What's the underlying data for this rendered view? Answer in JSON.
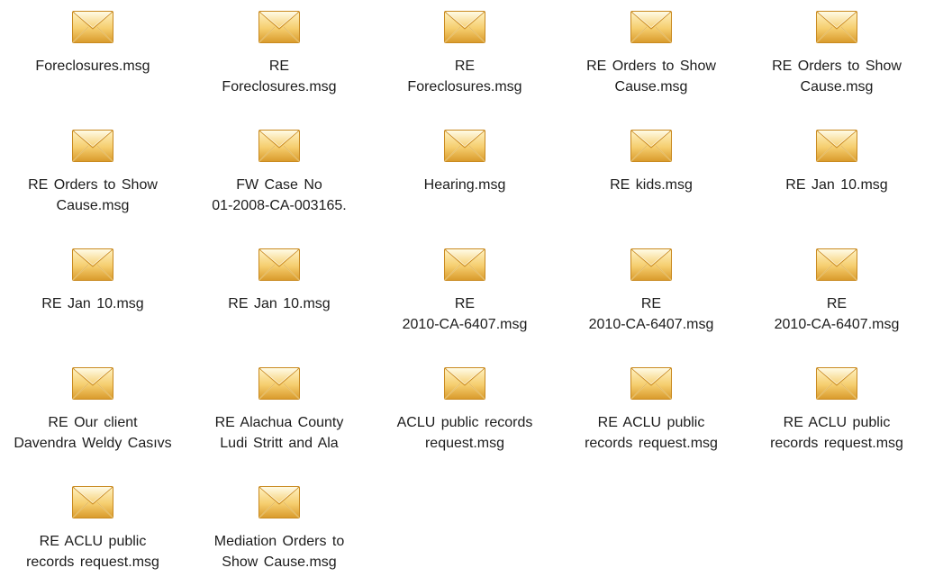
{
  "window": {
    "title": ""
  },
  "files": [
    {
      "name": "Foreclosures.msg",
      "icon": "email-message-icon"
    },
    {
      "name": "RE\nForeclosures.msg",
      "icon": "email-message-icon"
    },
    {
      "name": "RE\nForeclosures.msg",
      "icon": "email-message-icon"
    },
    {
      "name": "RE  Orders to Show\nCause.msg",
      "icon": "email-message-icon"
    },
    {
      "name": "RE  Orders to Show\nCause.msg",
      "icon": "email-message-icon"
    },
    {
      "name": "RE  Orders to Show\nCause.msg",
      "icon": "email-message-icon"
    },
    {
      "name": "FW  Case No\n01-2008-CA-003165.",
      "icon": "email-message-icon"
    },
    {
      "name": "Hearing.msg",
      "icon": "email-message-icon"
    },
    {
      "name": "RE  kids.msg",
      "icon": "email-message-icon"
    },
    {
      "name": "RE  Jan 10.msg",
      "icon": "email-message-icon"
    },
    {
      "name": "RE  Jan 10.msg",
      "icon": "email-message-icon"
    },
    {
      "name": "RE  Jan 10.msg",
      "icon": "email-message-icon"
    },
    {
      "name": "RE\n2010-CA-6407.msg",
      "icon": "email-message-icon"
    },
    {
      "name": "RE\n2010-CA-6407.msg",
      "icon": "email-message-icon"
    },
    {
      "name": "RE\n2010-CA-6407.msg",
      "icon": "email-message-icon"
    },
    {
      "name": "RE  Our client\nDavendra Weldy Casıvs",
      "icon": "email-message-icon"
    },
    {
      "name": "RE  Alachua County\nLudi Stritt and Ala",
      "icon": "email-message-icon"
    },
    {
      "name": "ACLU public records\nrequest.msg",
      "icon": "email-message-icon"
    },
    {
      "name": "RE  ACLU public\nrecords request.msg",
      "icon": "email-message-icon"
    },
    {
      "name": "RE  ACLU public\nrecords request.msg",
      "icon": "email-message-icon"
    },
    {
      "name": "RE  ACLU public\nrecords request.msg",
      "icon": "email-message-icon"
    },
    {
      "name": "Mediation Orders to\nShow Cause.msg",
      "icon": "email-message-icon"
    }
  ],
  "colors": {
    "envelope_light": "#fff3c4",
    "envelope_mid": "#f5cd6e",
    "envelope_dark": "#d99a2b",
    "envelope_border": "#c98a20",
    "label_text": "#1c1c1c"
  }
}
